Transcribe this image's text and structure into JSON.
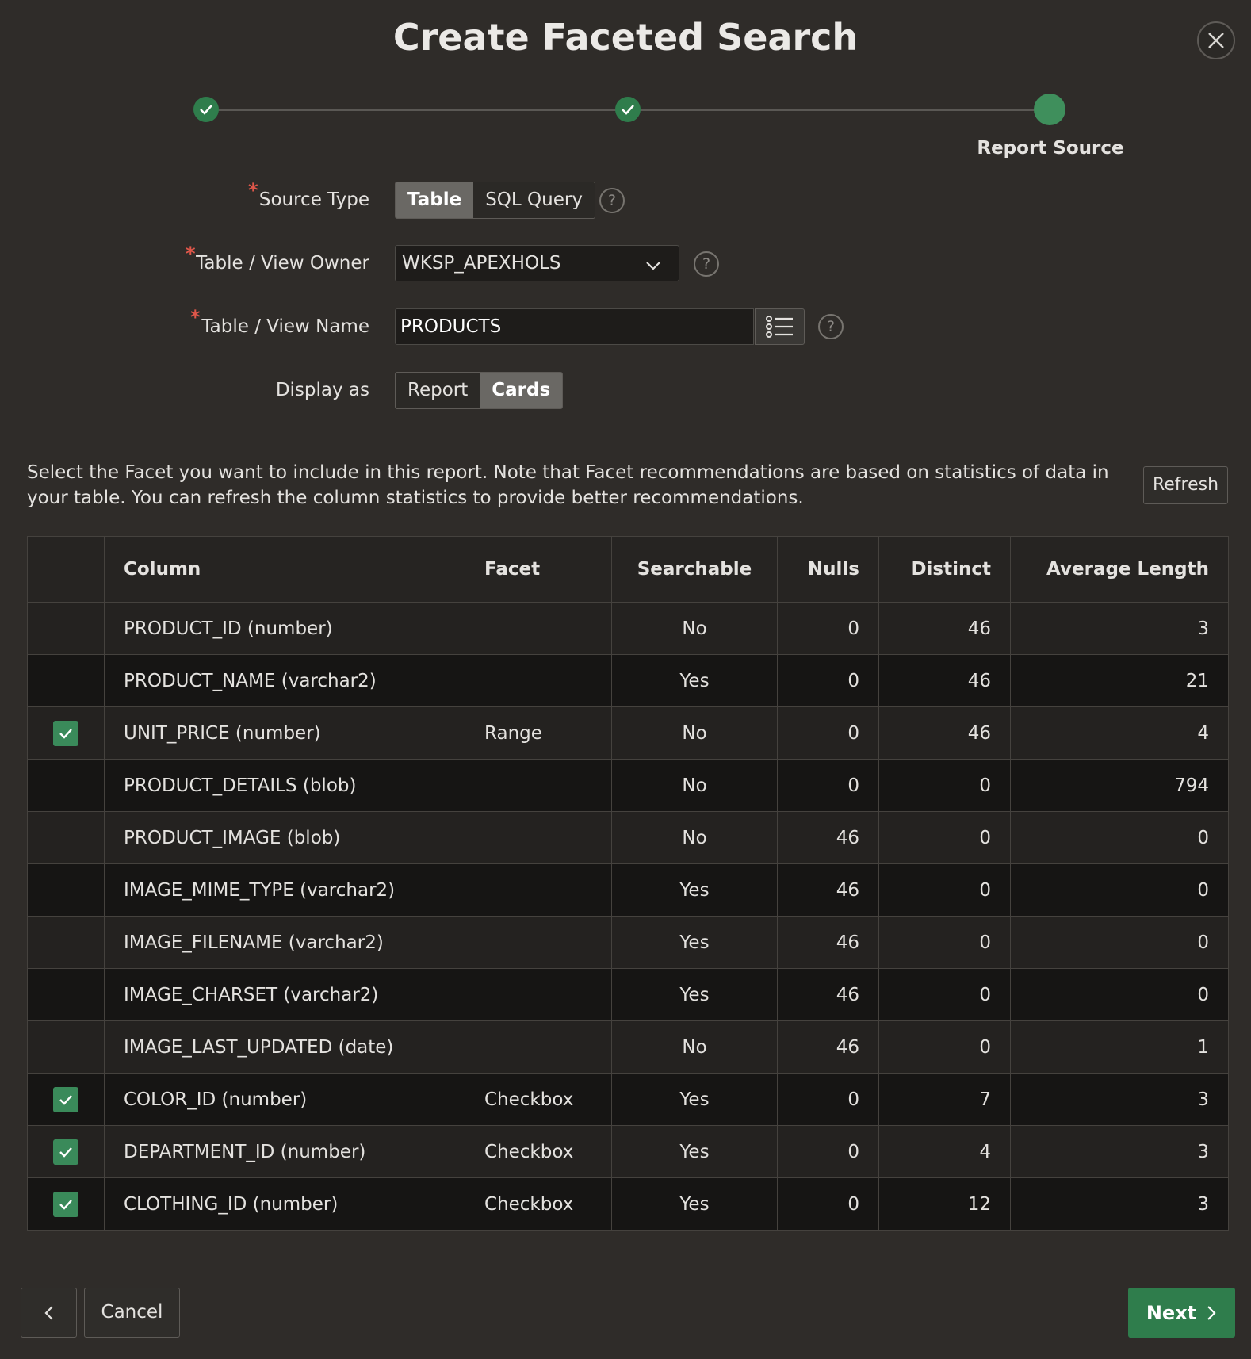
{
  "dialog": {
    "title": "Create Faceted Search"
  },
  "wizard": {
    "current_step_label": "Report Source"
  },
  "form": {
    "source_type": {
      "label": "Source Type",
      "options": [
        "Table",
        "SQL Query"
      ],
      "selected": "Table"
    },
    "owner": {
      "label": "Table / View Owner",
      "value": "WKSP_APEXHOLS"
    },
    "table_name": {
      "label": "Table / View Name",
      "value": "PRODUCTS"
    },
    "display_as": {
      "label": "Display as",
      "options": [
        "Report",
        "Cards"
      ],
      "selected": "Cards"
    },
    "help_glyph": "?"
  },
  "facets": {
    "description": "Select the Facet you want to include in this report. Note that Facet recommendations are based on statistics of data in your table. You can refresh the column statistics to provide better recommendations.",
    "refresh_label": "Refresh",
    "headers": {
      "column": "Column",
      "facet": "Facet",
      "searchable": "Searchable",
      "nulls": "Nulls",
      "distinct": "Distinct",
      "avg_length": "Average Length"
    },
    "rows": [
      {
        "checked": false,
        "column": "PRODUCT_ID (number)",
        "facet": "",
        "searchable": "No",
        "nulls": "0",
        "distinct": "46",
        "avg_length": "3"
      },
      {
        "checked": false,
        "column": "PRODUCT_NAME (varchar2)",
        "facet": "",
        "searchable": "Yes",
        "nulls": "0",
        "distinct": "46",
        "avg_length": "21"
      },
      {
        "checked": true,
        "column": "UNIT_PRICE (number)",
        "facet": "Range",
        "searchable": "No",
        "nulls": "0",
        "distinct": "46",
        "avg_length": "4"
      },
      {
        "checked": false,
        "column": "PRODUCT_DETAILS (blob)",
        "facet": "",
        "searchable": "No",
        "nulls": "0",
        "distinct": "0",
        "avg_length": "794"
      },
      {
        "checked": false,
        "column": "PRODUCT_IMAGE (blob)",
        "facet": "",
        "searchable": "No",
        "nulls": "46",
        "distinct": "0",
        "avg_length": "0"
      },
      {
        "checked": false,
        "column": "IMAGE_MIME_TYPE (varchar2)",
        "facet": "",
        "searchable": "Yes",
        "nulls": "46",
        "distinct": "0",
        "avg_length": "0"
      },
      {
        "checked": false,
        "column": "IMAGE_FILENAME (varchar2)",
        "facet": "",
        "searchable": "Yes",
        "nulls": "46",
        "distinct": "0",
        "avg_length": "0"
      },
      {
        "checked": false,
        "column": "IMAGE_CHARSET (varchar2)",
        "facet": "",
        "searchable": "Yes",
        "nulls": "46",
        "distinct": "0",
        "avg_length": "0"
      },
      {
        "checked": false,
        "column": "IMAGE_LAST_UPDATED (date)",
        "facet": "",
        "searchable": "No",
        "nulls": "46",
        "distinct": "0",
        "avg_length": "1"
      },
      {
        "checked": true,
        "column": "COLOR_ID (number)",
        "facet": "Checkbox",
        "searchable": "Yes",
        "nulls": "0",
        "distinct": "7",
        "avg_length": "3"
      },
      {
        "checked": true,
        "column": "DEPARTMENT_ID (number)",
        "facet": "Checkbox",
        "searchable": "Yes",
        "nulls": "0",
        "distinct": "4",
        "avg_length": "3"
      },
      {
        "checked": true,
        "column": "CLOTHING_ID (number)",
        "facet": "Checkbox",
        "searchable": "Yes",
        "nulls": "0",
        "distinct": "12",
        "avg_length": "3"
      }
    ]
  },
  "footer": {
    "cancel_label": "Cancel",
    "next_label": "Next"
  },
  "colors": {
    "accent_green": "#2f7d4c",
    "required_star": "#e0574a",
    "background": "#2f2c29"
  },
  "icons": [
    "close-icon",
    "check-icon",
    "chevron-down-icon",
    "list-icon",
    "help-icon",
    "chevron-left-icon",
    "chevron-right-icon"
  ]
}
